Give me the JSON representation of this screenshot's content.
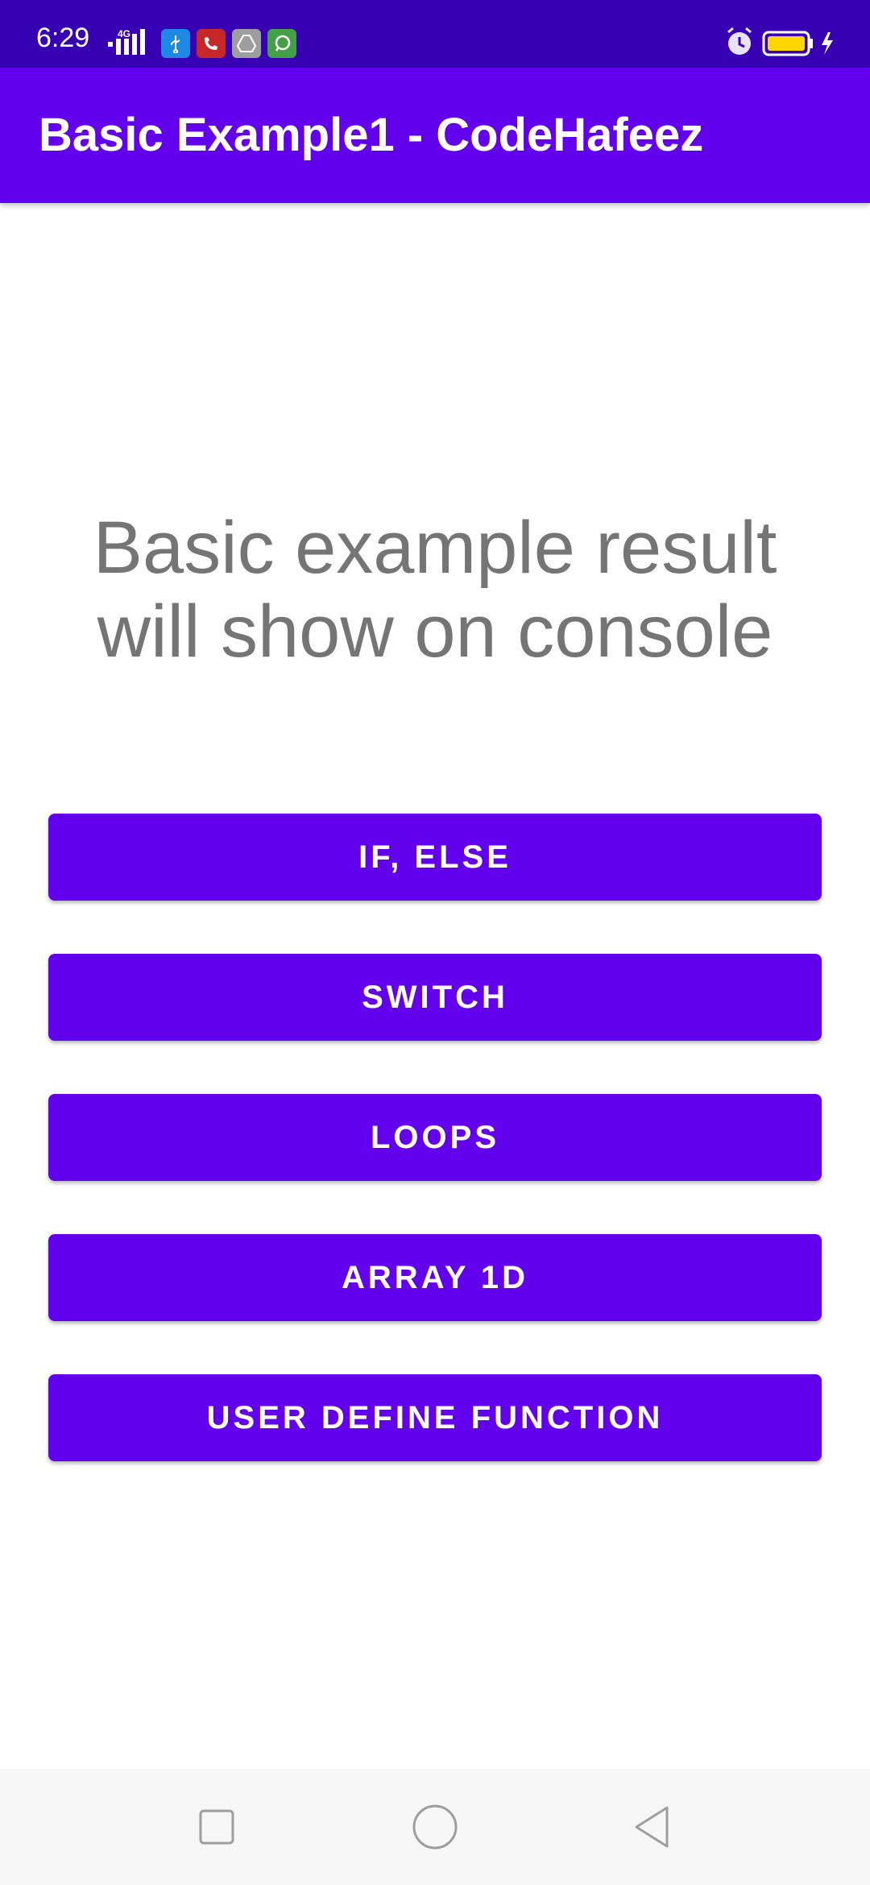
{
  "status_bar": {
    "time": "6:29",
    "network": "4G",
    "notification_icons": [
      "usb-icon",
      "call-recorder-icon",
      "drive-icon",
      "chat-icon"
    ],
    "alarm_icon": "alarm-icon",
    "battery_icon": "battery-icon",
    "charging_icon": "charging-icon"
  },
  "app_bar": {
    "title": "Basic Example1 - CodeHafeez"
  },
  "main": {
    "message": "Basic example result will show on console",
    "buttons": [
      {
        "label": "IF, ELSE"
      },
      {
        "label": "SWITCH"
      },
      {
        "label": "LOOPS"
      },
      {
        "label": "ARRAY 1D"
      },
      {
        "label": "USER DEFINE FUNCTION"
      }
    ]
  },
  "nav_bar": {
    "icons": [
      "recents-square-icon",
      "home-circle-icon",
      "back-triangle-icon"
    ]
  },
  "colors": {
    "status_bar": "#3700b3",
    "app_bar": "#6200ee",
    "button": "#6200ee",
    "message_text": "#757575",
    "nav_bar": "#f7f7f7"
  }
}
